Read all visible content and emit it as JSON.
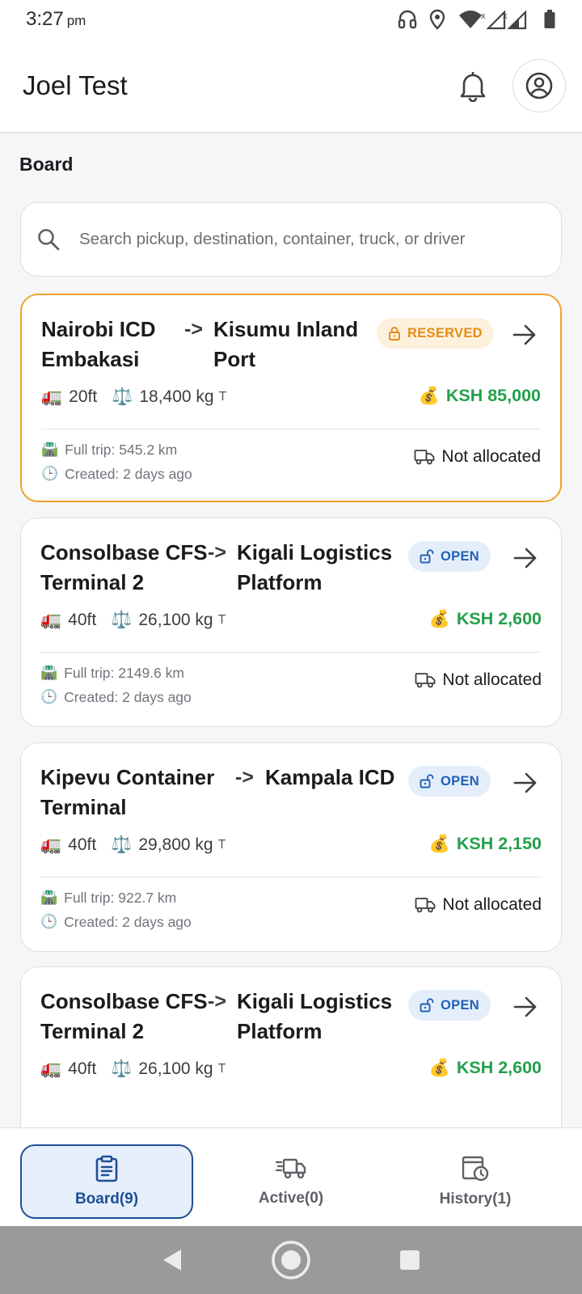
{
  "status_bar": {
    "time": "3:27",
    "ampm": "pm"
  },
  "header": {
    "title": "Joel Test"
  },
  "board": {
    "title": "Board",
    "search_placeholder": "Search pickup, destination, container, truck, or driver"
  },
  "cards": [
    {
      "from": "Nairobi ICD Embakasi",
      "arrow": "->",
      "to": "Kisumu Inland Port",
      "status": "RESERVED",
      "size": "20ft",
      "weight": "18,400 kg",
      "weight_unit": "T",
      "price": "KSH 85,000",
      "trip": "Full trip: 545.2 km",
      "created": "Created: 2 days ago",
      "allocation": "Not allocated"
    },
    {
      "from": "Consolbase CFS Terminal 2",
      "arrow": "->",
      "to": "Kigali Logistics Platform",
      "status": "OPEN",
      "size": "40ft",
      "weight": "26,100 kg",
      "weight_unit": "T",
      "price": "KSH 2,600",
      "trip": "Full trip: 2149.6 km",
      "created": "Created: 2 days ago",
      "allocation": "Not allocated"
    },
    {
      "from": "Kipevu Container Terminal",
      "arrow": "->",
      "to": "Kampala ICD",
      "status": "OPEN",
      "size": "40ft",
      "weight": "29,800 kg",
      "weight_unit": "T",
      "price": "KSH 2,150",
      "trip": "Full trip: 922.7 km",
      "created": "Created: 2 days ago",
      "allocation": "Not allocated"
    },
    {
      "from": "Consolbase CFS Terminal 2",
      "arrow": "->",
      "to": "Kigali Logistics Platform",
      "status": "OPEN",
      "size": "40ft",
      "weight": "26,100 kg",
      "weight_unit": "T",
      "price": "KSH 2,600"
    }
  ],
  "bottom_nav": {
    "board": "Board(9)",
    "active": "Active(0)",
    "history": "History(1)"
  },
  "icons": {
    "notification": "bell-icon",
    "profile": "account-circle-icon",
    "search": "search-icon",
    "reserved": "lock-icon",
    "open": "unlock-icon",
    "go": "arrow-right-icon",
    "container": "truck-emoji-icon",
    "weight": "scales-emoji-icon",
    "price": "money-bag-emoji-icon",
    "trip": "road-emoji-icon",
    "created": "clock-emoji-icon",
    "allocation": "truck-outline-icon"
  },
  "colors": {
    "reserved_border": "#f0a12a",
    "reserved_text": "#e78c12",
    "open_text": "#2261b3",
    "price": "#22a04a",
    "nav_active": "#1f4e95"
  }
}
